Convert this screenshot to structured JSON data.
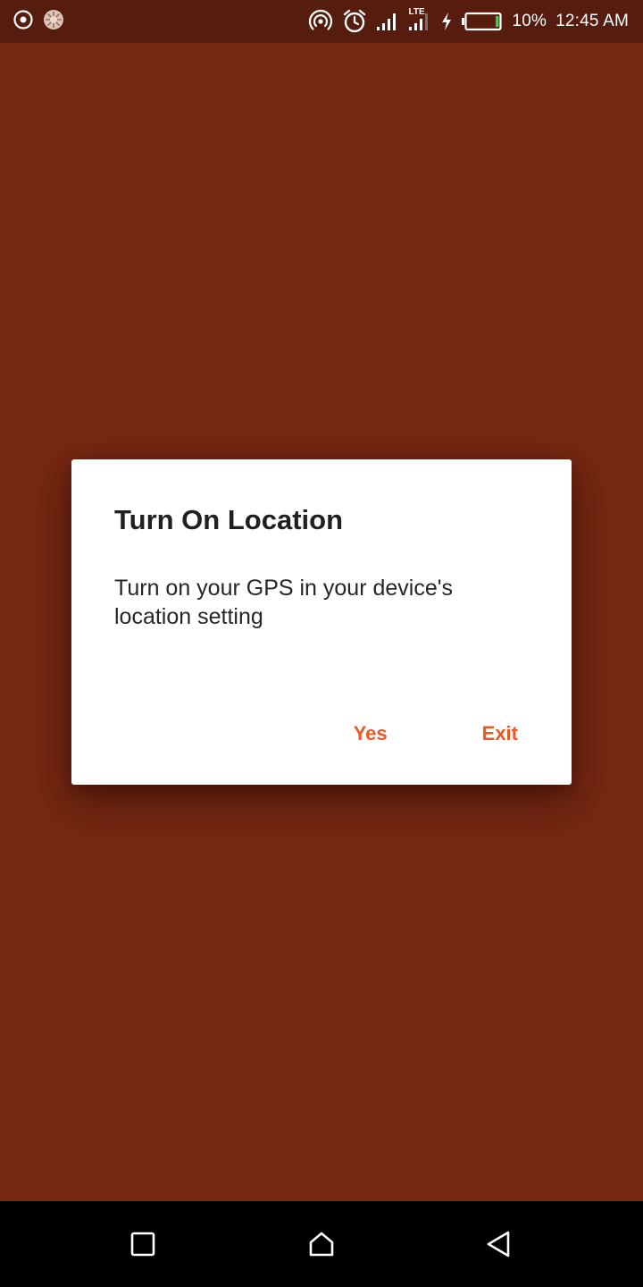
{
  "status_bar": {
    "icons_left": [
      "circle-target-icon",
      "sun-badge-icon"
    ],
    "icons_right": [
      "hotspot-icon",
      "alarm-icon",
      "signal-icon",
      "lte-signal-icon",
      "charging-icon",
      "battery-icon"
    ],
    "lte_label": "LTE",
    "battery_percent": "10%",
    "time": "12:45 AM",
    "battery_level": 0.1
  },
  "dialog": {
    "title": "Turn On Location",
    "message": "Turn on your GPS in your device's location setting",
    "buttons": {
      "yes": "Yes",
      "exit": "Exit"
    }
  },
  "nav_bar": {
    "icons": [
      "recents-icon",
      "home-icon",
      "back-icon"
    ]
  },
  "colors": {
    "background": "#762813",
    "status_bar": "#561c0d",
    "accent": "#ef5722",
    "dialog_bg": "#ffffff"
  }
}
